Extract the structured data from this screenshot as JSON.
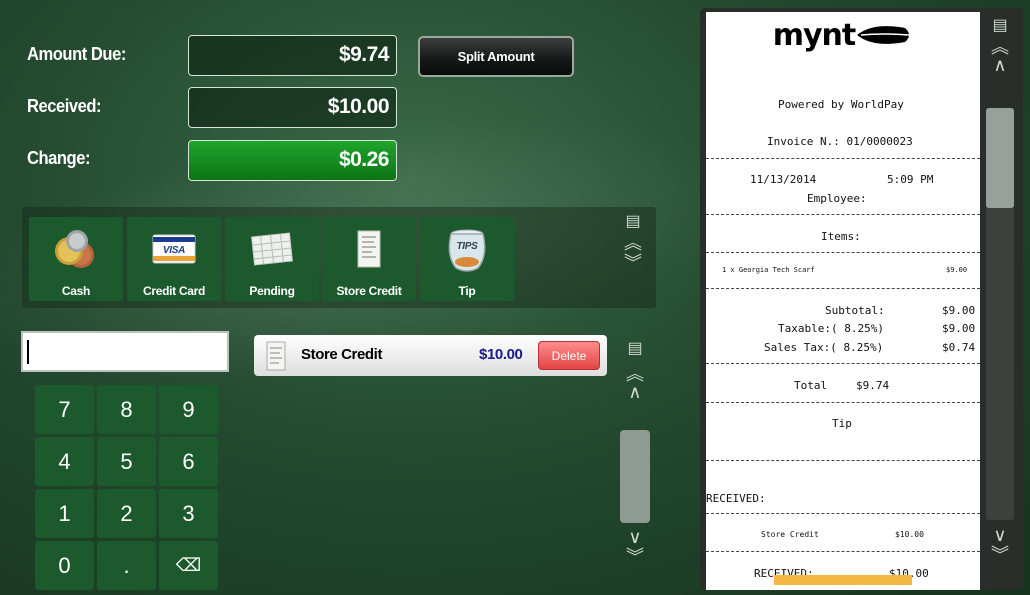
{
  "summary": {
    "amount_due_label": "Amount Due:",
    "amount_due_value": "$9.74",
    "received_label": "Received:",
    "received_value": "$10.00",
    "change_label": "Change:",
    "change_value": "$0.26",
    "split_label": "Split Amount"
  },
  "tenders": [
    {
      "label": "Cash",
      "icon": "coins-icon"
    },
    {
      "label": "Credit Card",
      "icon": "visa-card-icon"
    },
    {
      "label": "Pending",
      "icon": "calendar-icon"
    },
    {
      "label": "Store Credit",
      "icon": "receipt-icon"
    },
    {
      "label": "Tip",
      "icon": "tip-jar-icon"
    }
  ],
  "visa_text": "VISA",
  "tips_text": "TIPS",
  "keypad": {
    "keys": [
      "7",
      "8",
      "9",
      "4",
      "5",
      "6",
      "1",
      "2",
      "3",
      "0",
      ".",
      "⌫"
    ]
  },
  "payment": {
    "name": "Store Credit",
    "amount": "$10.00",
    "delete_label": "Delete"
  },
  "receipt": {
    "logo": "mynt",
    "powered_by": "Powered by WorldPay",
    "invoice": "Invoice N.: 01/0000023",
    "date": "11/13/2014",
    "time": "5:09 PM",
    "employee": "Employee:",
    "items_header": "Items:",
    "item_line": "1 x Georgia Tech Scarf",
    "item_amount": "$9.00",
    "subtotal_label": "Subtotal:",
    "subtotal_value": "$9.00",
    "taxable_label": "Taxable:( 8.25%)",
    "taxable_value": "$9.00",
    "salestax_label": "Sales Tax:( 8.25%)",
    "salestax_value": "$0.74",
    "total_label": "Total",
    "total_value": "$9.74",
    "tip_label": "Tip",
    "received_label": "RECEIVED:",
    "received_method": "Store Credit",
    "received_method_amount": "$10.00",
    "received_total_label": "RECEIVED:",
    "received_total_value": "$10.00"
  },
  "colors": {
    "accent_green": "#1fa52c",
    "tile_green": "#1c5a2e",
    "delete_red": "#e24545",
    "amount_blue": "#1b1b8a"
  }
}
